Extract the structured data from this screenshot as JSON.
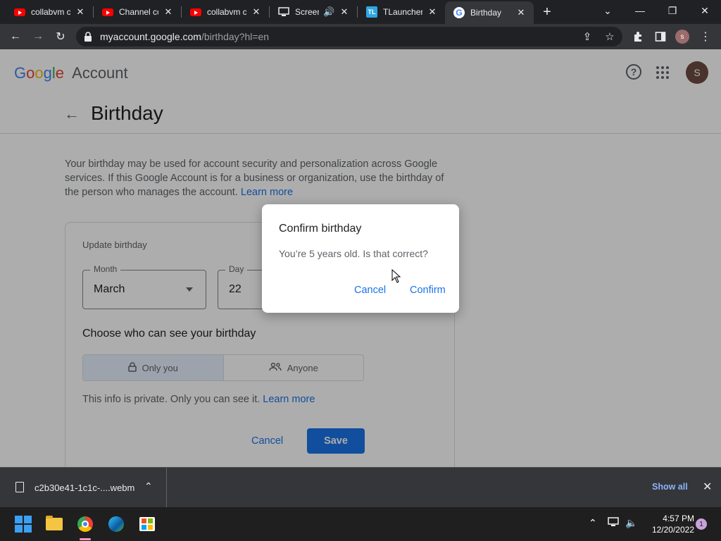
{
  "browser": {
    "tabs": [
      {
        "title": "collabvm cl",
        "favicon": "youtube-icon",
        "active": false
      },
      {
        "title": "Channel co",
        "favicon": "youtube-icon",
        "active": false
      },
      {
        "title": "collabvm cl",
        "favicon": "youtube-icon",
        "active": false
      },
      {
        "title": "Screen",
        "favicon": "screen-icon",
        "active": false,
        "audio": true
      },
      {
        "title": "TLauncher",
        "favicon": "tlauncher-icon",
        "active": false
      },
      {
        "title": "Birthday",
        "favicon": "google-icon",
        "active": true
      }
    ],
    "tl_badge": "TL",
    "google_favicon": "G",
    "url_host": "myaccount.google.com",
    "url_path": "/birthday?hl=en",
    "profile_initial": "s"
  },
  "page": {
    "logo_word": "Google",
    "logo_suffix": "Account",
    "avatar_initial": "S",
    "help_glyph": "?",
    "title": "Birthday",
    "description": "Your birthday may be used for account security and personalization across Google services. If this Google Account is for a business or organization, use the birthday of the person who manages the account.",
    "learn_more": "Learn more",
    "update_label": "Update birthday",
    "month_label": "Month",
    "month_value": "March",
    "day_label": "Day",
    "day_value": "22",
    "visibility_title": "Choose who can see your birthday",
    "option_only_you": "Only you",
    "option_anyone": "Anyone",
    "private_note": "This info is private. Only you can see it.",
    "private_learn_more": "Learn more",
    "cancel_label": "Cancel",
    "save_label": "Save"
  },
  "dialog": {
    "title": "Confirm birthday",
    "body": "You’re 5 years old. Is that correct?",
    "cancel_label": "Cancel",
    "confirm_label": "Confirm"
  },
  "downloads": {
    "filename": "c2b30e41-1c1c-....webm",
    "show_all": "Show all"
  },
  "taskbar": {
    "time": "4:57 PM",
    "date": "12/20/2022",
    "notification_count": "1"
  },
  "colors": {
    "accent": "#1a73e8",
    "chrome_dark": "#202124",
    "chrome_toolbar": "#35363a"
  }
}
